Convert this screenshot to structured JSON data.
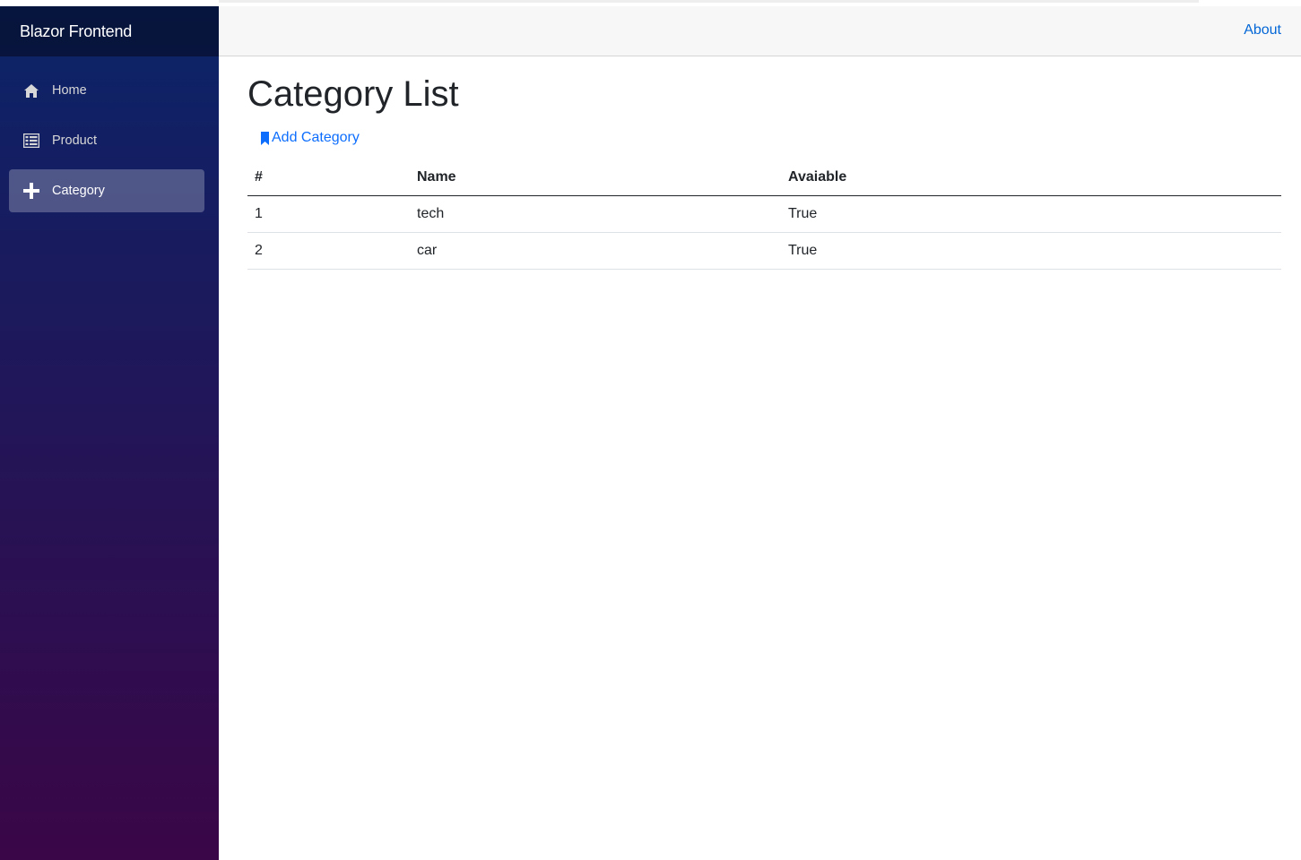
{
  "app": {
    "brand": "Blazor Frontend"
  },
  "nav": {
    "items": [
      {
        "label": "Home",
        "icon": "home-icon"
      },
      {
        "label": "Product",
        "icon": "list-icon"
      },
      {
        "label": "Category",
        "icon": "plus-icon",
        "active": true
      }
    ]
  },
  "header": {
    "about_label": "About"
  },
  "page": {
    "title": "Category List",
    "add_link_label": "Add Category",
    "add_link_icon": "bookmark-icon"
  },
  "table": {
    "headers": [
      "#",
      "Name",
      "Avaiable"
    ],
    "rows": [
      [
        "1",
        "tech",
        "True"
      ],
      [
        "2",
        "car",
        "True"
      ]
    ]
  },
  "colors": {
    "sidebar_top": "#0b2468",
    "sidebar_bottom": "#3a0647",
    "link": "#0366d6",
    "add_link": "#0d6efd"
  }
}
